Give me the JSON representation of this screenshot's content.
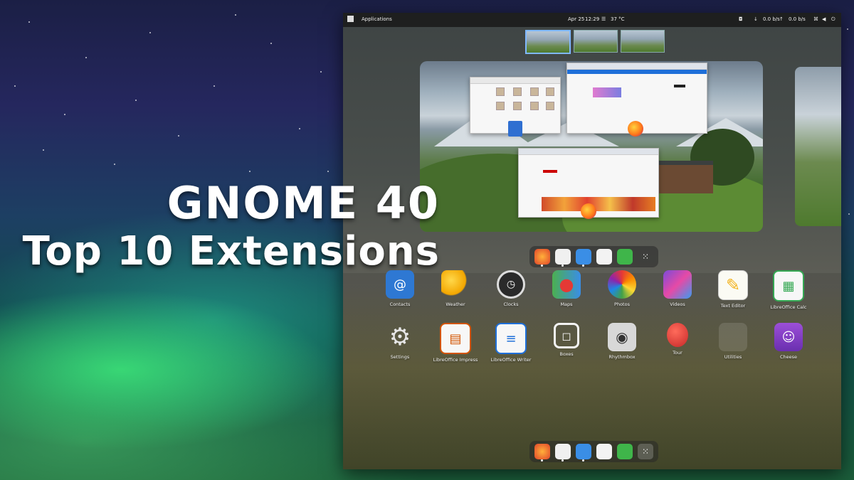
{
  "thumbnail": {
    "title_line1": "GNOME 40",
    "title_line2": "Top 10 Extensions"
  },
  "topbar": {
    "activities_label": "Applications",
    "date": "Apr 25",
    "time": "12:29",
    "weather": "37 °C",
    "net_down": "0.0 b/s",
    "net_up": "0.0 b/s"
  },
  "workspaces": {
    "count": 3,
    "active_index": 0
  },
  "dock": {
    "items": [
      {
        "name": "Firefox",
        "icon": "firefox-icon",
        "running": true
      },
      {
        "name": "Files",
        "icon": "files-icon",
        "running": true
      },
      {
        "name": "Text Editor",
        "icon": "text-editor-icon",
        "running": true
      },
      {
        "name": "Software",
        "icon": "software-icon",
        "running": false
      },
      {
        "name": "Extensions",
        "icon": "extensions-icon",
        "running": false
      },
      {
        "name": "Show Applications",
        "icon": "app-grid-icon",
        "running": false
      }
    ]
  },
  "app_grid": {
    "row1": [
      {
        "label": "Contacts",
        "icon": "contacts-icon"
      },
      {
        "label": "Weather",
        "icon": "weather-icon"
      },
      {
        "label": "Clocks",
        "icon": "clocks-icon"
      },
      {
        "label": "Maps",
        "icon": "maps-icon"
      },
      {
        "label": "Photos",
        "icon": "photos-icon"
      },
      {
        "label": "Videos",
        "icon": "videos-icon"
      },
      {
        "label": "Text Editor",
        "icon": "text-editor-icon"
      },
      {
        "label": "LibreOffice Calc",
        "icon": "calc-icon"
      }
    ],
    "row2": [
      {
        "label": "Settings",
        "icon": "settings-icon"
      },
      {
        "label": "LibreOffice Impress",
        "icon": "impress-icon"
      },
      {
        "label": "LibreOffice Writer",
        "icon": "writer-icon"
      },
      {
        "label": "Boxes",
        "icon": "boxes-icon"
      },
      {
        "label": "Rhythmbox",
        "icon": "rhythmbox-icon"
      },
      {
        "label": "Tour",
        "icon": "tour-icon"
      },
      {
        "label": "Utilities",
        "icon": "utilities-folder-icon"
      },
      {
        "label": "Cheese",
        "icon": "cheese-icon"
      }
    ]
  },
  "colors": {
    "accent": "#7fb8ff",
    "topbar": "#1e1f1f"
  }
}
